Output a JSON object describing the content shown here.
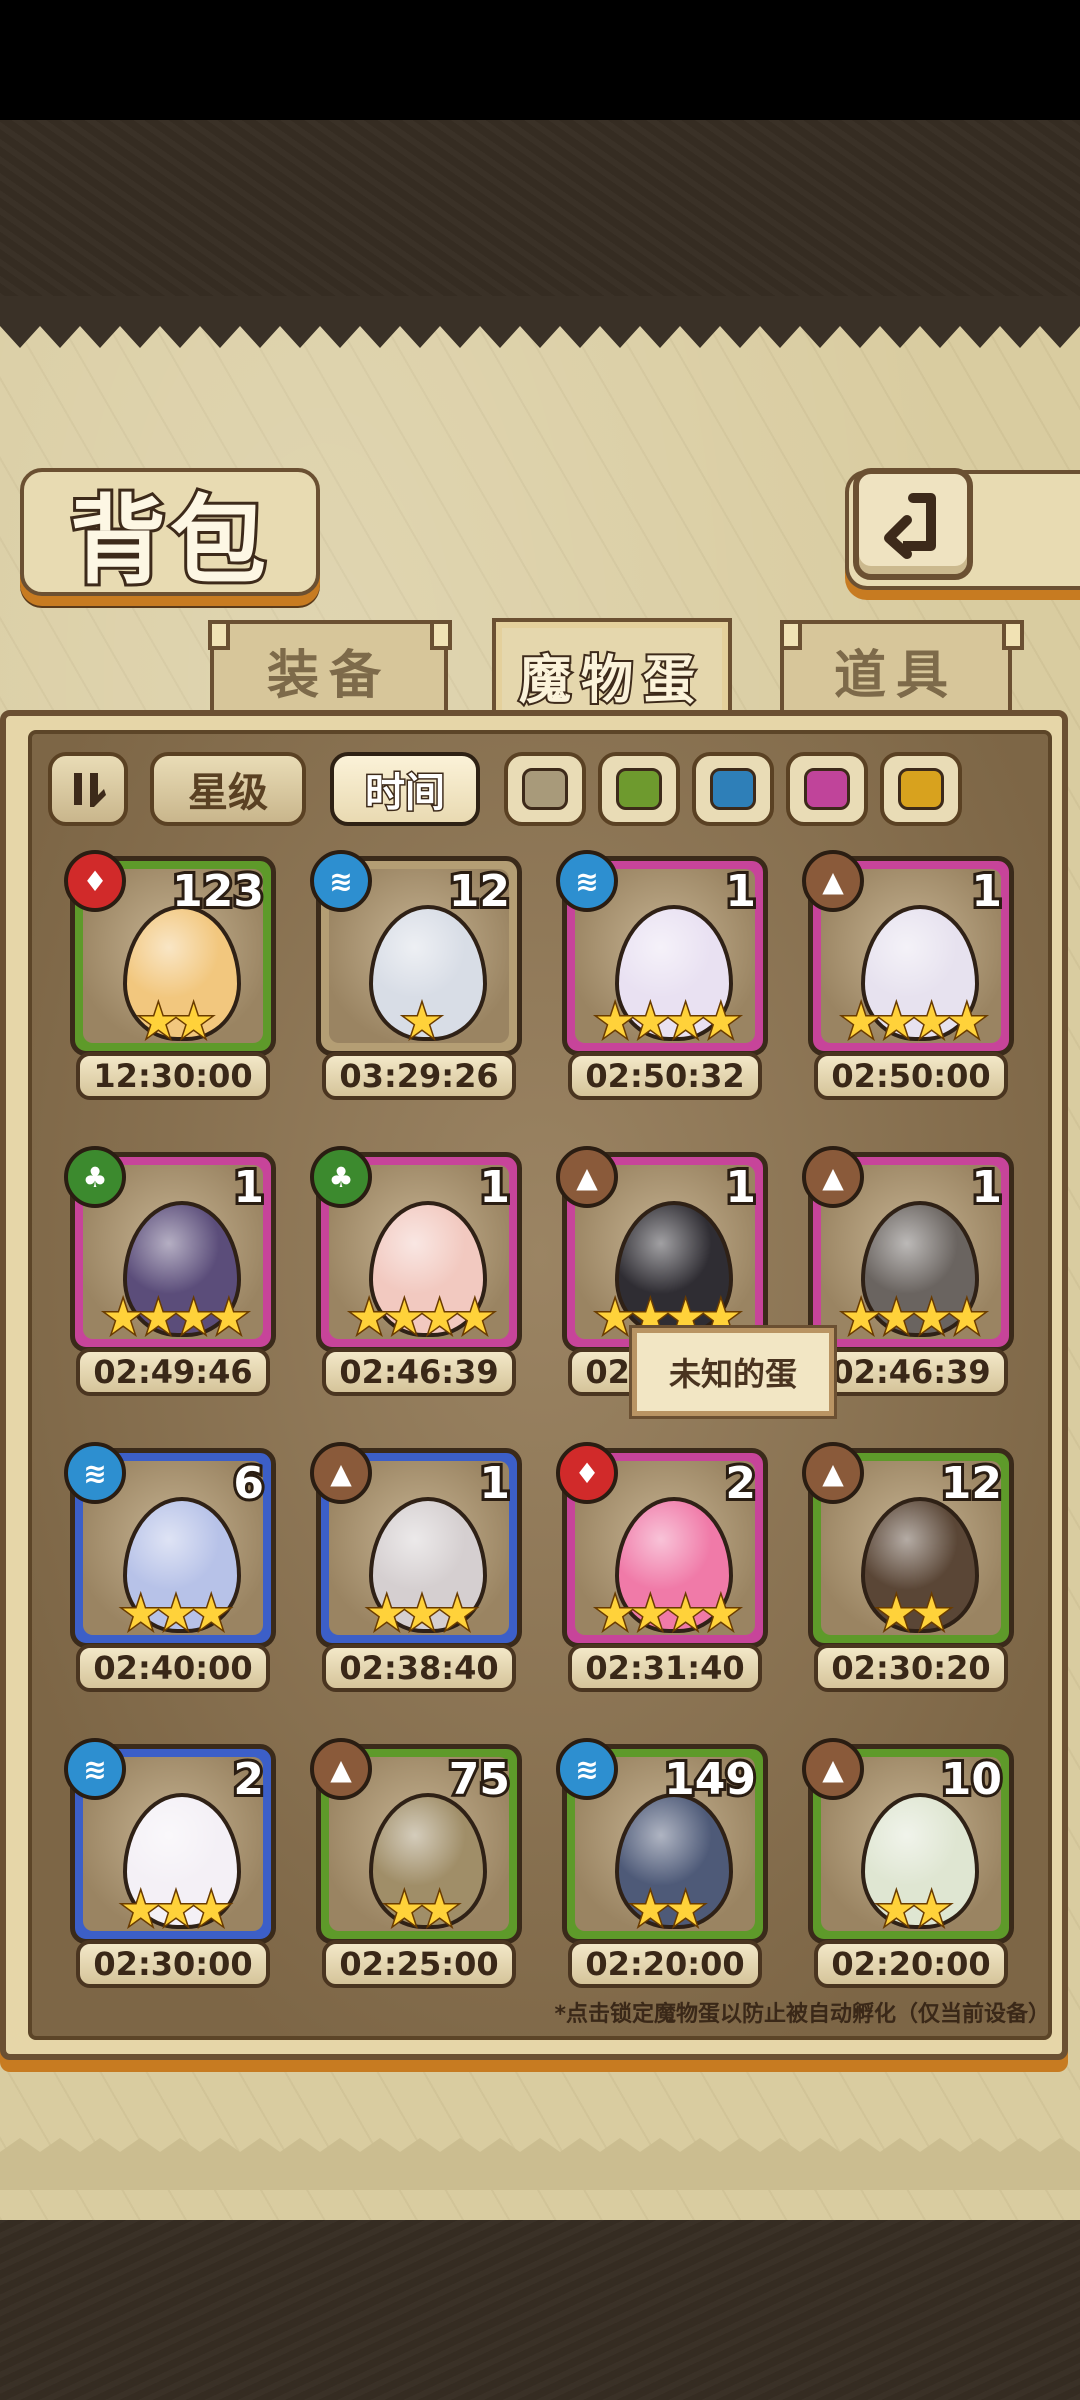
{
  "header": {
    "title": "背包",
    "back_icon": "back-arrow-icon"
  },
  "tabs": [
    {
      "label": "装备",
      "active": false
    },
    {
      "label": "魔物蛋",
      "active": true
    },
    {
      "label": "道具",
      "active": false
    }
  ],
  "filters": {
    "sort_icon": "sort-toggle-icon",
    "star_label": "星级",
    "time_label": "时间",
    "swatches": [
      "#a89a7a",
      "#6e9a2e",
      "#2e7fb8",
      "#c0449a",
      "#d8a21e"
    ]
  },
  "eggs": [
    {
      "count": "123",
      "stars": "★★",
      "timer": "12:30:00",
      "element": "fire",
      "frame": "#5e9a2a",
      "color": "#f2c77e"
    },
    {
      "count": "12",
      "stars": "★",
      "timer": "03:29:26",
      "element": "water",
      "frame": "#b49e74",
      "color": "#d8dde6"
    },
    {
      "count": "1",
      "stars": "★★★★",
      "timer": "02:50:32",
      "element": "water",
      "frame": "#c7449a",
      "color": "#e9e1f2"
    },
    {
      "count": "1",
      "stars": "★★★★",
      "timer": "02:50:00",
      "element": "earth",
      "frame": "#c7449a",
      "color": "#e7e2ef"
    },
    {
      "count": "1",
      "stars": "★★★★",
      "timer": "02:49:46",
      "element": "leaf",
      "frame": "#c7449a",
      "color": "#5b4d7a"
    },
    {
      "count": "1",
      "stars": "★★★★",
      "timer": "02:46:39",
      "element": "leaf",
      "frame": "#c7449a",
      "color": "#f2c9c0"
    },
    {
      "count": "1",
      "stars": "★★★★",
      "timer": "02:46:39",
      "element": "earth",
      "frame": "#c7449a",
      "color": "#2f2d33"
    },
    {
      "count": "1",
      "stars": "★★★★",
      "timer": "02:46:39",
      "element": "earth",
      "frame": "#c7449a",
      "color": "#6a6460"
    },
    {
      "count": "6",
      "stars": "★★★",
      "timer": "02:40:00",
      "element": "water",
      "frame": "#3c5fc8",
      "color": "#b7c2e8"
    },
    {
      "count": "1",
      "stars": "★★★",
      "timer": "02:38:40",
      "element": "earth",
      "frame": "#3c5fc8",
      "color": "#d5cfd0"
    },
    {
      "count": "2",
      "stars": "★★★★",
      "timer": "02:31:40",
      "element": "fire",
      "frame": "#c7449a",
      "color": "#f07aa8"
    },
    {
      "count": "12",
      "stars": "★★",
      "timer": "02:30:20",
      "element": "earth",
      "frame": "#5e9a2a",
      "color": "#5a4636"
    },
    {
      "count": "2",
      "stars": "★★★",
      "timer": "02:30:00",
      "element": "water",
      "frame": "#3c5fc8",
      "color": "#f4f0f6"
    },
    {
      "count": "75",
      "stars": "★★",
      "timer": "02:25:00",
      "element": "earth",
      "frame": "#5e9a2a",
      "color": "#a08e68"
    },
    {
      "count": "149",
      "stars": "★★",
      "timer": "02:20:00",
      "element": "water",
      "frame": "#5e9a2a",
      "color": "#4e5a78"
    },
    {
      "count": "10",
      "stars": "★★",
      "timer": "02:20:00",
      "element": "earth",
      "frame": "#5e9a2a",
      "color": "#dfe6d2"
    }
  ],
  "tooltip": "未知的蛋",
  "footnote": "*点击锁定魔物蛋以防止被自动孵化（仅当前设备）",
  "element_colors": {
    "fire": "#d12a2a",
    "water": "#2d8fd0",
    "earth": "#8a5a3a",
    "leaf": "#3c8a2e"
  },
  "element_glyphs": {
    "fire": "♦",
    "water": "≋",
    "earth": "▲",
    "leaf": "♣"
  }
}
